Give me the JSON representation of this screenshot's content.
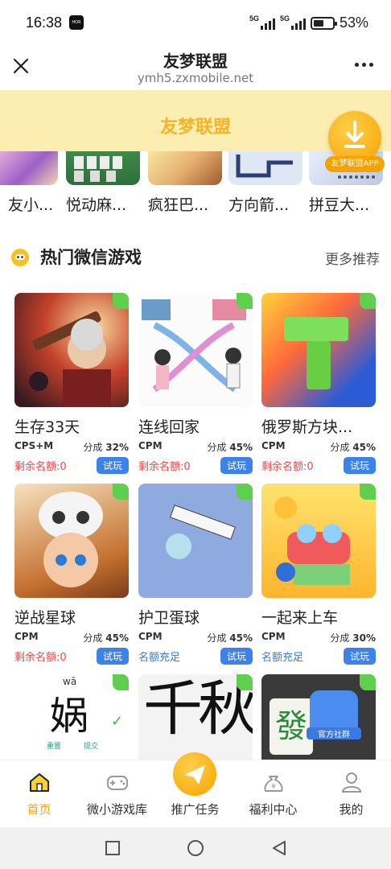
{
  "status": {
    "time": "16:38",
    "sim1": "5G",
    "sim2": "5G",
    "battery": "53%",
    "battery_level": 0.53
  },
  "header": {
    "title": "友梦联盟",
    "url": "ymh5.zxmobile.net"
  },
  "banner": {
    "title": "友梦联盟",
    "download_label": "友梦联盟APP"
  },
  "carousel": [
    {
      "name": "友小..."
    },
    {
      "name": "悦动麻..."
    },
    {
      "name": "疯狂巴..."
    },
    {
      "name": "方向箭..."
    },
    {
      "name": "拼豆大..."
    }
  ],
  "section": {
    "title": "热门微信游戏",
    "more": "更多推荐"
  },
  "games": [
    {
      "name": "生存33天",
      "model": "CPS+M",
      "share_label": "分成",
      "share": "32%",
      "quota": "剩余名额:0",
      "try": "试玩"
    },
    {
      "name": "连线回家",
      "model": "CPM",
      "share_label": "分成",
      "share": "45%",
      "quota": "剩余名额:0",
      "try": "试玩"
    },
    {
      "name": "俄罗斯方块...",
      "model": "CPM",
      "share_label": "分成",
      "share": "45%",
      "quota": "剩余名额:0",
      "try": "试玩"
    },
    {
      "name": "逆战星球",
      "model": "CPM",
      "share_label": "分成",
      "share": "45%",
      "quota": "剩余名额:0",
      "try": "试玩"
    },
    {
      "name": "护卫蛋球",
      "model": "CPM",
      "share_label": "分成",
      "share": "45%",
      "quota": "名额充足",
      "try": "试玩"
    },
    {
      "name": "一起来上车",
      "model": "CPM",
      "share_label": "分成",
      "share": "30%",
      "quota": "名额充足",
      "try": "试玩"
    }
  ],
  "partial_games": [
    {
      "glyph": "娲",
      "pinyin": "wā",
      "b1": "重置",
      "b2": "提交"
    },
    {
      "glyph": "千秋"
    },
    {
      "glyph": "發",
      "badge": "官方社群"
    }
  ],
  "tabs": [
    {
      "label": "首页"
    },
    {
      "label": "微小游戏库"
    },
    {
      "label": "推广任务"
    },
    {
      "label": "福利中心"
    },
    {
      "label": "我的"
    }
  ],
  "colors": {
    "accent": "#f3a814",
    "banner_bg": "#fcedb0",
    "try_button": "#3c82e8",
    "quota_empty": "#e84c4c",
    "quota_ok": "#3a7bd5"
  }
}
